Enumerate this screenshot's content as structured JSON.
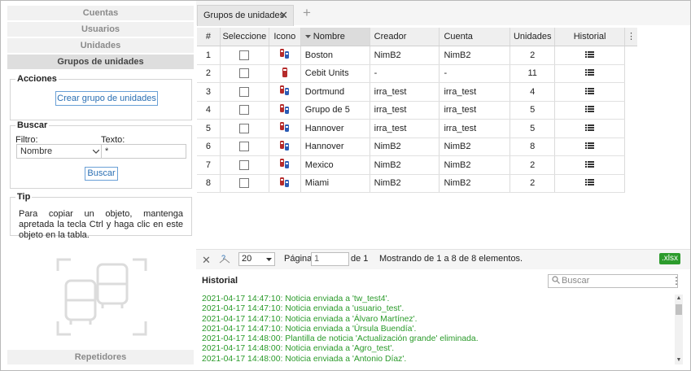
{
  "sidebar": {
    "items": [
      {
        "label": "Cuentas"
      },
      {
        "label": "Usuarios"
      },
      {
        "label": "Unidades"
      },
      {
        "label": "Grupos de unidades"
      }
    ],
    "acciones": {
      "title": "Acciones",
      "create_button": "Crear grupo de unidades"
    },
    "buscar": {
      "title": "Buscar",
      "filtro_label": "Filtro:",
      "filtro_value": "Nombre",
      "texto_label": "Texto:",
      "texto_value": "*",
      "search_button": "Buscar"
    },
    "tip": {
      "title": "Tip",
      "text": "Para copiar un objeto, mantenga apretada la tecla Ctrl y haga clic en este objeto en la tabla."
    },
    "repetidores": "Repetidores"
  },
  "tab": {
    "label": "Grupos de unidades",
    "close": "✕",
    "add": "+"
  },
  "table": {
    "headers": [
      "#",
      "Seleccione",
      "Icono",
      "Nombre",
      "Creador",
      "Cuenta",
      "Unidades",
      "Historial"
    ],
    "sorted_column": "Nombre",
    "rows": [
      {
        "num": "1",
        "name": "Boston",
        "creator": "NimB2",
        "account": "NimB2",
        "units": "2",
        "icon": "multi-vehicle-icon"
      },
      {
        "num": "2",
        "name": "Cebit Units",
        "creator": "-",
        "account": "-",
        "units": "11",
        "icon": "single-vehicle-icon"
      },
      {
        "num": "3",
        "name": "Dortmund",
        "creator": "irra_test",
        "account": "irra_test",
        "units": "4",
        "icon": "multi-vehicle-icon"
      },
      {
        "num": "4",
        "name": "Grupo de 5",
        "creator": "irra_test",
        "account": "irra_test",
        "units": "5",
        "icon": "multi-vehicle-icon"
      },
      {
        "num": "5",
        "name": "Hannover",
        "creator": "irra_test",
        "account": "irra_test",
        "units": "5",
        "icon": "multi-vehicle-icon"
      },
      {
        "num": "6",
        "name": "Hannover",
        "creator": "NimB2",
        "account": "NimB2",
        "units": "8",
        "icon": "multi-vehicle-icon"
      },
      {
        "num": "7",
        "name": "Mexico",
        "creator": "NimB2",
        "account": "NimB2",
        "units": "2",
        "icon": "multi-vehicle-icon"
      },
      {
        "num": "8",
        "name": "Miami",
        "creator": "NimB2",
        "account": "NimB2",
        "units": "2",
        "icon": "multi-vehicle-icon"
      }
    ]
  },
  "pager": {
    "page_size": "20",
    "page_label": "Página",
    "page_value": "1",
    "of_label": "de 1",
    "summary": "Mostrando de 1 a 8 de 8 elementos.",
    "export": ".xlsx"
  },
  "history": {
    "title": "Historial",
    "search_placeholder": "Buscar",
    "lines": [
      "2021-04-17 14:47:10: Noticia enviada a 'tw_test4'.",
      "2021-04-17 14:47:10: Noticia enviada a 'usuario_test'.",
      "2021-04-17 14:47:10: Noticia enviada a 'Álvaro Martínez'.",
      "2021-04-17 14:47:10: Noticia enviada a 'Úrsula Buendía'.",
      "2021-04-17 14:48:00: Plantilla de noticia 'Actualización grande' eliminada.",
      "2021-04-17 14:48:00: Noticia enviada a 'Agro_test'.",
      "2021-04-17 14:48:00: Noticia enviada a 'Antonio Díaz'."
    ]
  },
  "colors": {
    "accent": "#2a6fb3",
    "log_green": "#2a9a2a",
    "export_green": "#2c9b2c"
  }
}
